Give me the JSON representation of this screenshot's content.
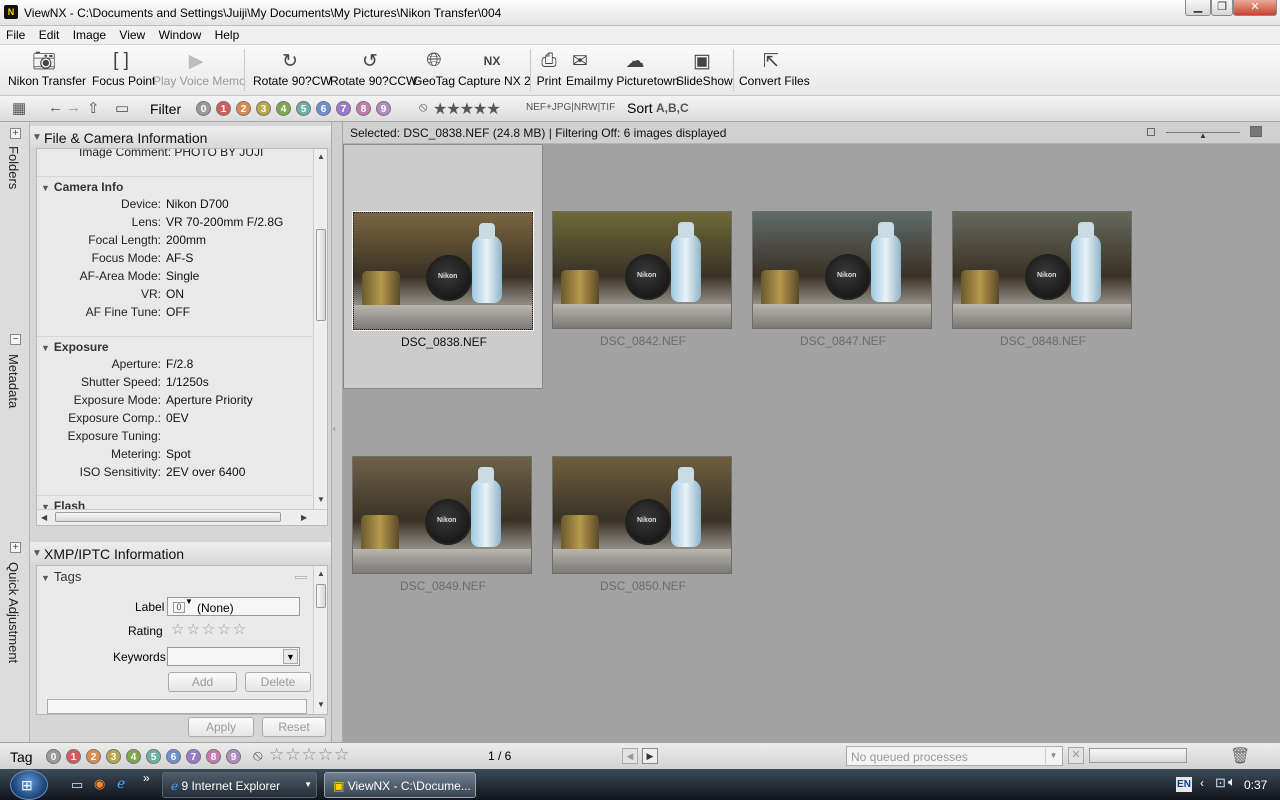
{
  "window": {
    "title": "ViewNX - C:\\Documents and Settings\\Juiji\\My Documents\\My Pictures\\Nikon Transfer\\004",
    "minimize": "▁",
    "maximize": "❐",
    "close": "✕"
  },
  "menu": [
    "File",
    "Edit",
    "Image",
    "View",
    "Window",
    "Help"
  ],
  "toolbar": {
    "nikon_transfer": "Nikon Transfer",
    "focus_point": "Focus Point",
    "play_voice_memo": "Play Voice Memo",
    "rotate_cw": "Rotate 90?CW",
    "rotate_ccw": "Rotate 90?CCW",
    "geotag": "GeoTag",
    "capture_nx": "Capture NX 2",
    "print": "Print",
    "email": "Email",
    "my_picturetown": "my Picturetown",
    "slideshow": "SlideShow",
    "convert_files": "Convert Files"
  },
  "filterbar": {
    "filter_label": "Filter",
    "labels": [
      "0",
      "1",
      "2",
      "3",
      "4",
      "5",
      "6",
      "7",
      "8",
      "9"
    ],
    "label_colors": [
      "#9a9a9a",
      "#d35b5b",
      "#d88c4e",
      "#b7a64a",
      "#7ea650",
      "#6ab0a4",
      "#6e8fd0",
      "#9a7acc",
      "#c57bb0",
      "#b08cc0"
    ],
    "stars": "★★★★★",
    "file_types": "NEF+JPG|NRW|TIF",
    "sort_label": "Sort",
    "sort_glyph": "A,B,C"
  },
  "left_tabs": {
    "folders": "Folders",
    "metadata": "Metadata",
    "quick_adjustment": "Quick Adjustment"
  },
  "metadata_panel": {
    "header": "File & Camera Information",
    "image_comment_row": "Image Comment:  PHOTO BY JUJI",
    "camera_info": {
      "title": "Camera Info",
      "rows": [
        {
          "k": "Device:",
          "v": "Nikon D700"
        },
        {
          "k": "Lens:",
          "v": "VR 70-200mm F/2.8G"
        },
        {
          "k": "Focal Length:",
          "v": "200mm"
        },
        {
          "k": "Focus Mode:",
          "v": "AF-S"
        },
        {
          "k": "AF-Area Mode:",
          "v": "Single"
        },
        {
          "k": "VR:",
          "v": "ON"
        },
        {
          "k": "AF Fine Tune:",
          "v": "OFF"
        }
      ]
    },
    "exposure": {
      "title": "Exposure",
      "rows": [
        {
          "k": "Aperture:",
          "v": "F/2.8"
        },
        {
          "k": "Shutter Speed:",
          "v": "1/1250s"
        },
        {
          "k": "Exposure Mode:",
          "v": "Aperture Priority"
        },
        {
          "k": "Exposure Comp.:",
          "v": "0EV"
        },
        {
          "k": "Exposure Tuning:",
          "v": ""
        },
        {
          "k": "Metering:",
          "v": "Spot"
        },
        {
          "k": "ISO Sensitivity:",
          "v": "2EV over 6400"
        }
      ]
    },
    "flash_title": "Flash"
  },
  "xmp_panel": {
    "header": "XMP/IPTC Information",
    "tags_title": "Tags",
    "label_key": "Label",
    "label_num": "0",
    "label_value": "(None)",
    "rating_key": "Rating",
    "rating_stars": "☆☆☆☆☆",
    "keywords_key": "Keywords",
    "add": "Add",
    "delete": "Delete",
    "apply": "Apply",
    "reset": "Reset"
  },
  "status": {
    "text": "Selected: DSC_0838.NEF (24.8 MB) | Filtering Off: 6 images displayed"
  },
  "thumbnails": [
    {
      "name": "DSC_0838.NEF",
      "selected": true,
      "tint": "#7a6540"
    },
    {
      "name": "DSC_0842.NEF",
      "selected": false,
      "tint": "#6f6a3a"
    },
    {
      "name": "DSC_0847.NEF",
      "selected": false,
      "tint": "#5f6b6b"
    },
    {
      "name": "DSC_0848.NEF",
      "selected": false,
      "tint": "#646a5c"
    },
    {
      "name": "DSC_0849.NEF",
      "selected": false,
      "tint": "#6d6248"
    },
    {
      "name": "DSC_0850.NEF",
      "selected": false,
      "tint": "#6d5f3e"
    }
  ],
  "bottombar": {
    "tag_label": "Tag",
    "labels": [
      "0",
      "1",
      "2",
      "3",
      "4",
      "5",
      "6",
      "7",
      "8",
      "9"
    ],
    "stars": "☆☆☆☆☆",
    "page": "1 / 6",
    "queue_placeholder": "No queued processes"
  },
  "taskbar": {
    "ie_task": "9 Internet Explorer",
    "viewnx_task": "ViewNX - C:\\Docume...",
    "lang": "EN",
    "time": "0:37"
  }
}
